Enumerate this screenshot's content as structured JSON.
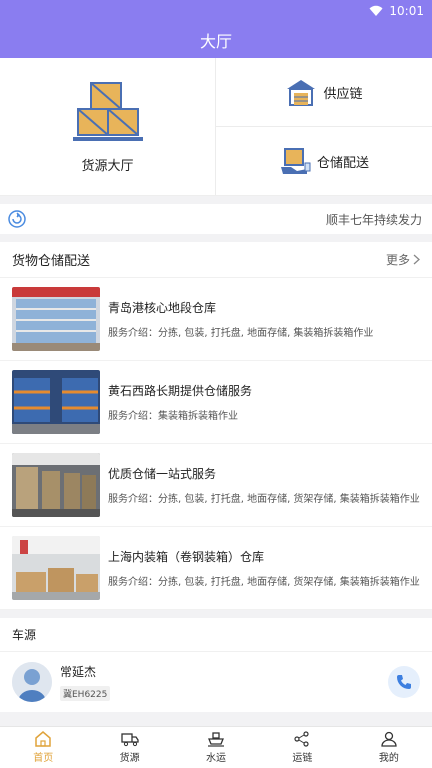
{
  "status_bar": {
    "time": "10:01"
  },
  "header": {
    "title": "大厅"
  },
  "hub": {
    "main": {
      "label": "货源大厅"
    },
    "supply_chain": {
      "label": "供应链"
    },
    "storage": {
      "label": "仓储配送"
    }
  },
  "notice": {
    "text": "顺丰七年持续发力"
  },
  "warehouse_section": {
    "title": "货物仓储配送",
    "more": "更多",
    "items": [
      {
        "title": "青岛港核心地段仓库",
        "desc": "服务介绍：分拣, 包装, 打托盘, 地面存储, 集装箱拆装箱作业"
      },
      {
        "title": "黄石西路长期提供仓储服务",
        "desc": "服务介绍：集装箱拆装箱作业"
      },
      {
        "title": "优质仓储一站式服务",
        "desc": "服务介绍：分拣, 包装, 打托盘, 地面存储, 货架存储, 集装箱拆装箱作业"
      },
      {
        "title": "上海内装箱（卷钢装箱）仓库",
        "desc": "服务介绍：分拣, 包装, 打托盘, 地面存储, 货架存储, 集装箱拆装箱作业"
      }
    ]
  },
  "vehicle_section": {
    "title": "车源",
    "items": [
      {
        "name": "常延杰",
        "plate": "冀EH6225"
      }
    ]
  },
  "tabbar": {
    "active": "首页",
    "tabs": [
      {
        "label": "首页",
        "icon": "home-icon"
      },
      {
        "label": "货源",
        "icon": "truck-icon"
      },
      {
        "label": "水运",
        "icon": "ship-icon"
      },
      {
        "label": "运链",
        "icon": "share-icon"
      },
      {
        "label": "我的",
        "icon": "user-icon"
      }
    ]
  },
  "colors": {
    "header": "#8a7df0",
    "active_tab": "#e0a33a",
    "icon_blue": "#4a6fb3",
    "box": "#e8b45a"
  }
}
